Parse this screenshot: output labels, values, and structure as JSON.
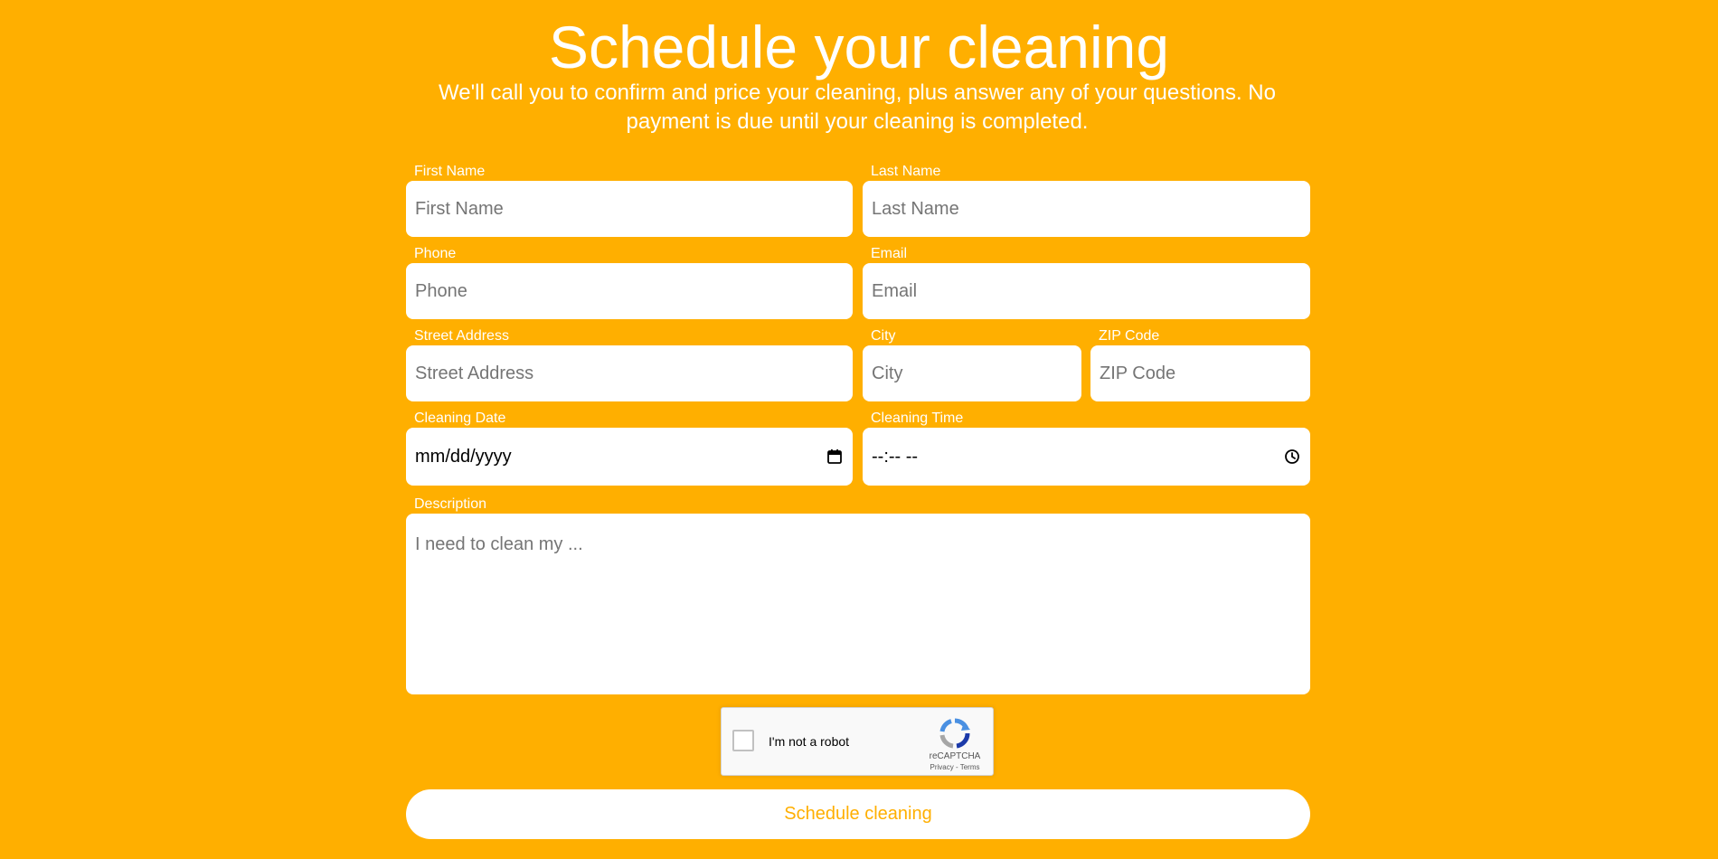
{
  "header": {
    "title": "Schedule your cleaning",
    "subtitle": "We'll call you to confirm and price your cleaning, plus answer any of your questions. No payment is due until your cleaning is completed."
  },
  "form": {
    "first_name": {
      "label": "First Name",
      "placeholder": "First Name",
      "value": ""
    },
    "last_name": {
      "label": "Last Name",
      "placeholder": "Last Name",
      "value": ""
    },
    "phone": {
      "label": "Phone",
      "placeholder": "Phone",
      "value": ""
    },
    "email": {
      "label": "Email",
      "placeholder": "Email",
      "value": ""
    },
    "street_address": {
      "label": "Street Address",
      "placeholder": "Street Address",
      "value": ""
    },
    "city": {
      "label": "City",
      "placeholder": "City",
      "value": ""
    },
    "zip": {
      "label": "ZIP Code",
      "placeholder": "ZIP Code",
      "value": ""
    },
    "cleaning_date": {
      "label": "Cleaning Date",
      "display": "mm/dd/yyyy",
      "icon": "calendar-icon"
    },
    "cleaning_time": {
      "label": "Cleaning Time",
      "display": "--:-- --",
      "icon": "clock-icon"
    },
    "description": {
      "label": "Description",
      "placeholder": "I need to clean my ...",
      "value": ""
    }
  },
  "captcha": {
    "checkbox_label": "I'm not a robot",
    "brand": "reCAPTCHA",
    "links": "Privacy - Terms",
    "checked": false,
    "icon": "recaptcha-logo-icon"
  },
  "submit": {
    "label": "Schedule cleaning"
  },
  "colors": {
    "background": "#FFAF00",
    "field_background": "#FFFFFF",
    "text_on_background": "#FFFFFF",
    "button_text": "#FFAF00"
  }
}
